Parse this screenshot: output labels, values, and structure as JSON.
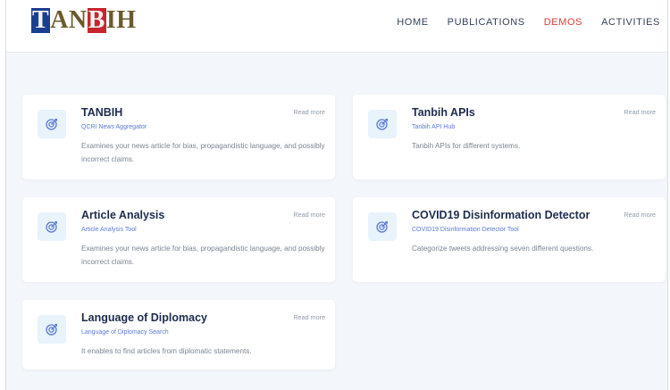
{
  "logo": {
    "part1": "T",
    "part2": "AN",
    "part3": "B",
    "part4": "IH"
  },
  "nav": [
    {
      "label": "HOME",
      "active": false
    },
    {
      "label": "PUBLICATIONS",
      "active": false
    },
    {
      "label": "DEMOS",
      "active": true
    },
    {
      "label": "ACTIVITIES",
      "active": false
    }
  ],
  "colors": {
    "accent": "#e03a3e",
    "icon": "#5b7bd5",
    "background": "#f3f6fa"
  },
  "cards": [
    {
      "title": "TANBIH",
      "subtitle": "QCRI News Aggregator",
      "description": "Examines your news article for bias, propagandistic language, and possibly incorrect claims.",
      "link": "Read more",
      "icon": "target-icon"
    },
    {
      "title": "Tanbih APIs",
      "subtitle": "Tanbih API Hub",
      "description": "Tanbih APIs for different systems.",
      "link": "Read more",
      "icon": "target-icon"
    },
    {
      "title": "Article Analysis",
      "subtitle": "Article Analysis Tool",
      "description": "Examines your news article for bias, propagandistic language, and possibly incorrect claims.",
      "link": "Read more",
      "icon": "target-icon"
    },
    {
      "title": "COVID19 Disinformation Detector",
      "subtitle": "COVID19 Disinformation Detector Tool",
      "description": "Categorize tweets addressing seven different questions.",
      "link": "Read more",
      "icon": "target-icon"
    },
    {
      "title": "Language of Diplomacy",
      "subtitle": "Language of Diplomacy Search",
      "description": "It enables to find articles from diplomatic statements.",
      "link": "Read more",
      "icon": "target-icon"
    }
  ]
}
